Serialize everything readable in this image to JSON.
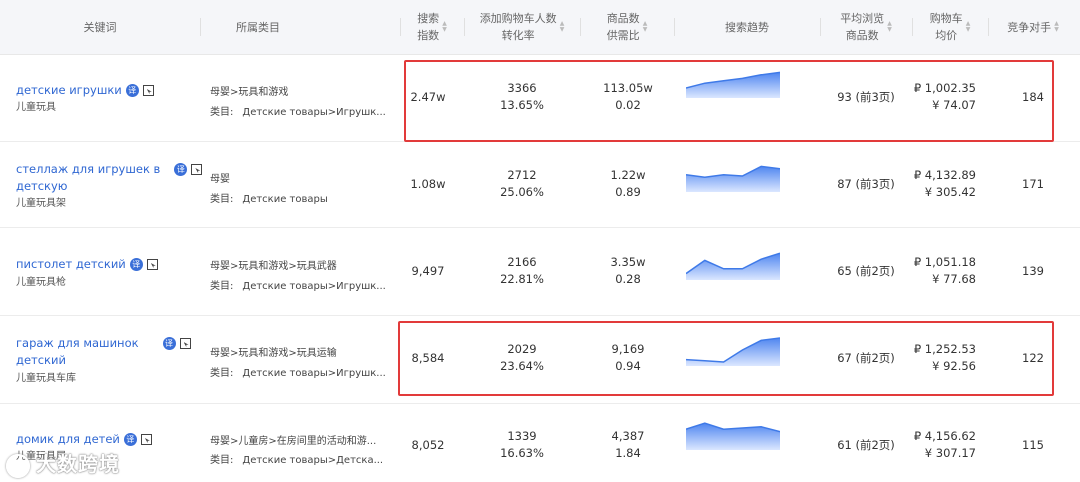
{
  "header": {
    "keyword": "关键词",
    "category": "所属类目",
    "search_index": [
      "搜索",
      "指数"
    ],
    "cart_users": [
      "添加购物车人数",
      "转化率"
    ],
    "supply_demand": [
      "商品数",
      "供需比"
    ],
    "trend": "搜索趋势",
    "avg_browse": [
      "平均浏览",
      "商品数"
    ],
    "cart_price": [
      "购物车",
      "均价"
    ],
    "competitors": "竞争对手"
  },
  "badge_label": "译",
  "rows": [
    {
      "keyword": "детские игрушки",
      "keyword_cn": "儿童玩具",
      "category_path": "母婴>玩具和游戏",
      "category_label": "类目:",
      "category_ru": "Детские товары>Игрушк...",
      "search_index": "2.47w",
      "cart_users": "3366",
      "conversion": "13.65%",
      "items": "113.05w",
      "ratio": "0.02",
      "trend": [
        0.25,
        0.45,
        0.55,
        0.65,
        0.8,
        0.9
      ],
      "avg_browse": "93 (前3页)",
      "price_rub": "₽ 1,002.35",
      "price_cny": "¥ 74.07",
      "competitors": "184"
    },
    {
      "keyword_lines": [
        "стеллаж для игрушек в",
        "детскую"
      ],
      "keyword_cn": "儿童玩具架",
      "category_path": "母婴",
      "category_label": "类目:",
      "category_ru": "Детские товары",
      "search_index": "1.08w",
      "cart_users": "2712",
      "conversion": "25.06%",
      "items": "1.22w",
      "ratio": "0.89",
      "trend": [
        0.55,
        0.45,
        0.55,
        0.5,
        0.9,
        0.8
      ],
      "avg_browse": "87 (前3页)",
      "price_rub": "₽ 4,132.89",
      "price_cny": "¥ 305.42",
      "competitors": "171"
    },
    {
      "keyword": "пистолет детский",
      "keyword_cn": "儿童玩具枪",
      "category_path": "母婴>玩具和游戏>玩具武器",
      "category_label": "类目:",
      "category_ru": "Детские товары>Игрушк...",
      "search_index": "9,497",
      "cart_users": "2166",
      "conversion": "22.81%",
      "items": "3.35w",
      "ratio": "0.28",
      "trend": [
        0.1,
        0.65,
        0.3,
        0.3,
        0.7,
        0.95
      ],
      "avg_browse": "65 (前2页)",
      "price_rub": "₽ 1,051.18",
      "price_cny": "¥ 77.68",
      "competitors": "139"
    },
    {
      "keyword_lines": [
        "гараж для машинок",
        "детский"
      ],
      "keyword_cn": "儿童玩具车库",
      "category_path": "母婴>玩具和游戏>玩具运输",
      "category_label": "类目:",
      "category_ru": "Детские товары>Игрушк...",
      "search_index": "8,584",
      "cart_users": "2029",
      "conversion": "23.64%",
      "items": "9,169",
      "ratio": "0.94",
      "trend": [
        0.1,
        0.05,
        0.0,
        0.5,
        0.9,
        1.0
      ],
      "avg_browse": "67 (前2页)",
      "price_rub": "₽ 1,252.53",
      "price_cny": "¥ 92.56",
      "competitors": "122"
    },
    {
      "keyword": "домик для детей",
      "keyword_cn": "儿童玩具屋",
      "category_path": "母婴>儿童房>在房间里的活动和游...",
      "category_label": "类目:",
      "category_ru": "Детские товары>Детска...",
      "search_index": "8,052",
      "cart_users": "1339",
      "conversion": "16.63%",
      "items": "4,387",
      "ratio": "1.84",
      "trend": [
        0.7,
        0.95,
        0.7,
        0.75,
        0.8,
        0.6
      ],
      "avg_browse": "61 (前2页)",
      "price_rub": "₽ 4,156.62",
      "price_cny": "¥ 307.17",
      "competitors": "115"
    }
  ],
  "watermark": "大数跨境"
}
